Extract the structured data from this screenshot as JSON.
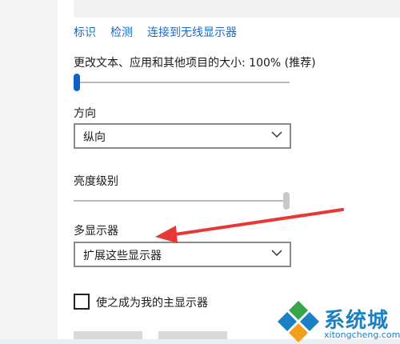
{
  "links": [
    "标识",
    "检测",
    "连接到无线显示器"
  ],
  "scale": {
    "label": "更改文本、应用和其他项目的大小: 100% (推荐)",
    "slider_value": 0.0
  },
  "orientation": {
    "label": "方向",
    "value": "纵向"
  },
  "brightness": {
    "label": "亮度级别",
    "slider_value": 1.0
  },
  "multi_display": {
    "label": "多显示器",
    "value": "扩展这些显示器"
  },
  "primary_display": {
    "label": "使之成为我的主显示器",
    "checked": false
  },
  "annotation": {
    "arrow_color": "#e53935"
  },
  "watermark": {
    "brand": "系统城",
    "domain": "xitongcheng.com",
    "logo_colors": [
      "#1b80c4",
      "#37a648",
      "#f2a01c"
    ]
  },
  "colors": {
    "accent": "#0a64c8",
    "link": "#1a6bc0"
  }
}
